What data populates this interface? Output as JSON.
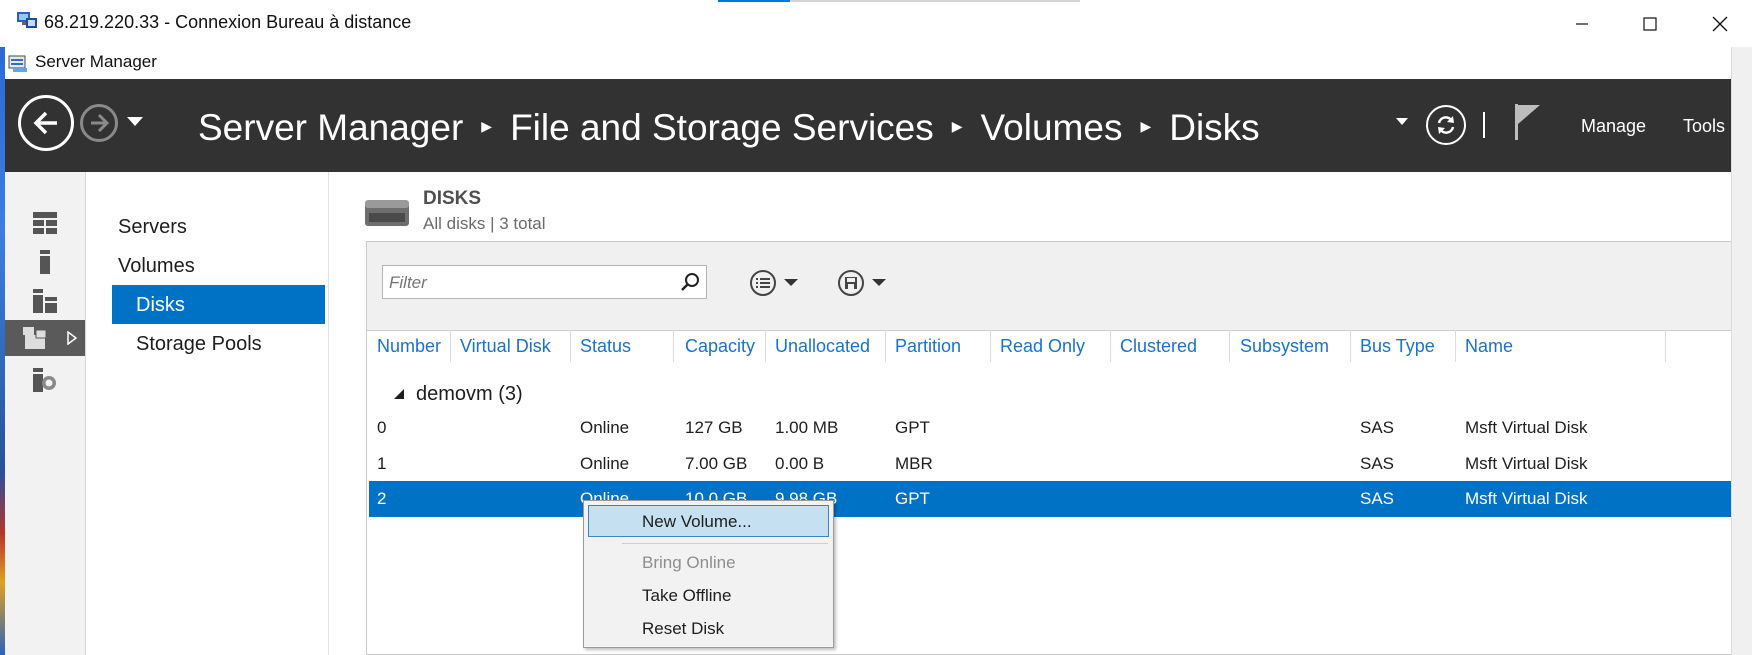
{
  "rdp_window": {
    "title": "68.219.220.33 - Connexion Bureau à distance",
    "icon": "remote-desktop-icon",
    "controls": [
      "minimize-icon",
      "maximize-icon",
      "close-icon"
    ]
  },
  "app": {
    "title": "Server Manager",
    "icon": "server-manager-icon"
  },
  "header": {
    "breadcrumb": [
      "Server Manager",
      "File and Storage Services",
      "Volumes",
      "Disks"
    ],
    "menus": {
      "manage": "Manage",
      "tools": "Tools"
    },
    "icons": [
      "back-icon",
      "forward-icon",
      "history-dropdown-icon",
      "refresh-icon",
      "notifications-flag-icon"
    ]
  },
  "icon_rail": [
    "dashboard-icon",
    "local-server-icon",
    "all-servers-icon",
    "file-storage-services-icon",
    "iis-icon"
  ],
  "nav": {
    "items": [
      "Servers",
      "Volumes",
      "Disks",
      "Storage Pools"
    ],
    "selected": "Disks"
  },
  "tile": {
    "title": "DISKS",
    "subtitle": "All disks | 3 total",
    "filter_placeholder": "Filter"
  },
  "table": {
    "columns": [
      "Number",
      "Virtual Disk",
      "Status",
      "Capacity",
      "Unallocated",
      "Partition",
      "Read Only",
      "Clustered",
      "Subsystem",
      "Bus Type",
      "Name"
    ],
    "group": "demovm (3)",
    "rows": [
      {
        "number": "0",
        "virtual_disk": "",
        "status": "Online",
        "capacity": "127 GB",
        "unallocated": "1.00 MB",
        "partition": "GPT",
        "read_only": "",
        "clustered": "",
        "subsystem": "",
        "bus_type": "SAS",
        "name": "Msft Virtual Disk"
      },
      {
        "number": "1",
        "virtual_disk": "",
        "status": "Online",
        "capacity": "7.00 GB",
        "unallocated": "0.00 B",
        "partition": "MBR",
        "read_only": "",
        "clustered": "",
        "subsystem": "",
        "bus_type": "SAS",
        "name": "Msft Virtual Disk"
      },
      {
        "number": "2",
        "virtual_disk": "",
        "status": "Online",
        "capacity": "10.0 GB",
        "unallocated": "9.98 GB",
        "partition": "GPT",
        "read_only": "",
        "clustered": "",
        "subsystem": "",
        "bus_type": "SAS",
        "name": "Msft Virtual Disk"
      }
    ],
    "selected_row": 2
  },
  "context_menu": {
    "items": [
      {
        "label": "New Volume...",
        "enabled": true,
        "highlighted": true
      },
      {
        "label": "Bring Online",
        "enabled": false
      },
      {
        "label": "Take Offline",
        "enabled": true
      },
      {
        "label": "Reset Disk",
        "enabled": true
      }
    ]
  },
  "colors": {
    "header_bg": "#323232",
    "selection": "#0072c6",
    "column_header_text": "#1a73c8",
    "menu_highlight": "#c5e0f0"
  }
}
